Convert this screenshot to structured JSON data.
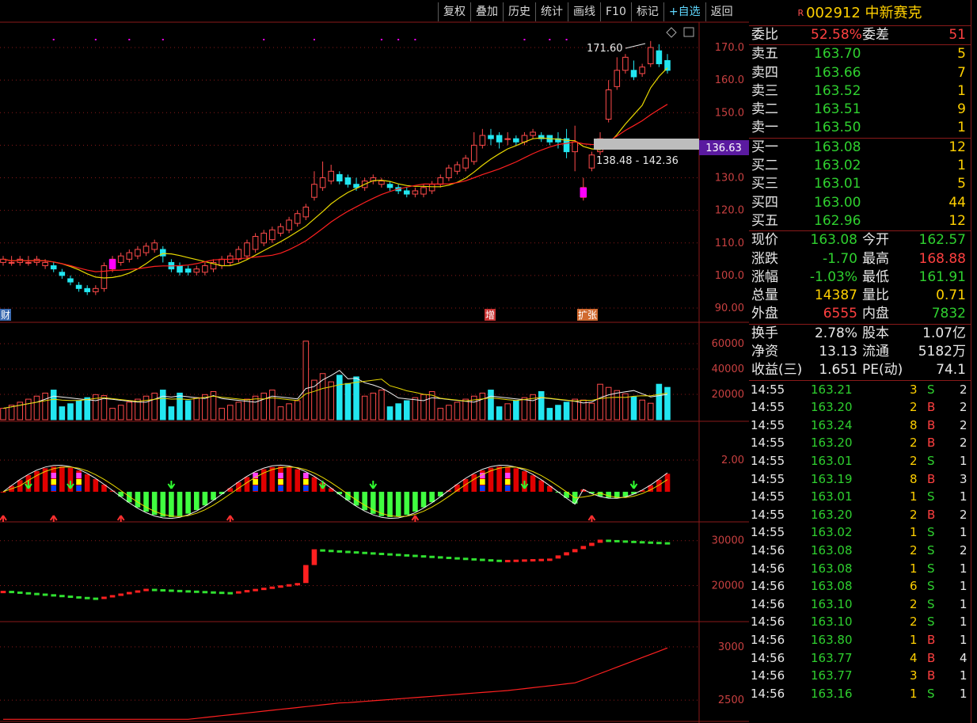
{
  "toolbar": {
    "buttons": [
      "复权",
      "叠加",
      "历史",
      "统计",
      "画线",
      "F10",
      "标记",
      "+自选",
      "返回"
    ]
  },
  "chart": {
    "price_axis": [
      "170.0",
      "160.0",
      "150.0",
      "140.0",
      "130.0",
      "120.0",
      "110.0",
      "100.0",
      "90.00"
    ],
    "cursor_price": "136.63",
    "high_label": "171.60",
    "range_label": "138.48 - 142.36",
    "badges": [
      "财",
      "增",
      "扩张"
    ],
    "volume_axis": [
      "60000",
      "40000",
      "20000"
    ],
    "macd_axis": [
      "2.00"
    ],
    "ind3_axis": [
      "30000",
      "20000"
    ],
    "ind4_axis": [
      "3000",
      "2500"
    ]
  },
  "chart_data": {
    "type": "candlestick",
    "x": [
      1,
      2,
      3,
      4,
      5,
      6,
      7,
      8,
      9,
      10,
      11,
      12,
      13,
      14,
      15,
      16,
      17,
      18,
      19,
      20,
      21,
      22,
      23,
      24,
      25,
      26,
      27,
      28,
      29,
      30,
      31,
      32,
      33,
      34,
      35,
      36,
      37,
      38,
      39,
      40,
      41,
      42,
      43,
      44,
      45,
      46,
      47,
      48,
      49,
      50,
      51,
      52,
      53,
      54,
      55,
      56,
      57,
      58,
      59,
      60,
      61,
      62,
      63,
      64,
      65,
      66,
      67,
      68,
      69,
      70,
      71,
      72,
      73,
      74
    ],
    "open": [
      104,
      104,
      104,
      104,
      104,
      103,
      103,
      101,
      99,
      97,
      96,
      95,
      96,
      102,
      104,
      105,
      106,
      107,
      108,
      108,
      104,
      103,
      102,
      101,
      101,
      102,
      103,
      104,
      105,
      106,
      108,
      110,
      111,
      113,
      114,
      116,
      118,
      124,
      127,
      129,
      131,
      130,
      128,
      127,
      129,
      128,
      128,
      127,
      126,
      125,
      125,
      126,
      128,
      130,
      132,
      133,
      135,
      140,
      143,
      143,
      142,
      142,
      141,
      143,
      143,
      143,
      142,
      142,
      138,
      124,
      133,
      138,
      148,
      158,
      163,
      163,
      162,
      165,
      169,
      166
    ],
    "close": [
      105,
      104,
      105,
      104,
      105,
      104,
      102,
      100,
      98,
      96,
      95,
      96,
      103,
      105,
      106,
      107,
      108,
      109,
      110,
      106,
      102,
      101,
      101,
      102,
      103,
      104,
      105,
      106,
      108,
      110,
      112,
      113,
      114,
      115,
      117,
      119,
      121,
      128,
      130,
      132,
      129,
      128,
      127,
      129,
      130,
      129,
      127,
      126,
      125,
      126,
      127,
      128,
      130,
      133,
      134,
      136,
      140,
      143,
      142,
      141,
      142,
      141,
      143,
      144,
      142,
      141,
      141,
      138,
      141,
      127,
      137,
      142,
      157,
      163,
      167,
      161,
      164,
      170,
      165,
      163
    ],
    "high": [
      106,
      106,
      106,
      106,
      106,
      105,
      104,
      102,
      100,
      98,
      97,
      97,
      104,
      106,
      107,
      108,
      109,
      110,
      111,
      109,
      105,
      104,
      103,
      103,
      104,
      105,
      106,
      107,
      109,
      111,
      113,
      114,
      115,
      116,
      118,
      120,
      122,
      132,
      135,
      134,
      132,
      131,
      130,
      130,
      131,
      130,
      129,
      128,
      127,
      127,
      128,
      129,
      131,
      134,
      135,
      137,
      144,
      145,
      145,
      144,
      144,
      143,
      144,
      145,
      144,
      143,
      144,
      145,
      146,
      130,
      138,
      144,
      160,
      167,
      168,
      166,
      165,
      172,
      171,
      168
    ],
    "low": [
      103,
      103,
      103,
      103,
      103,
      102,
      101,
      99,
      97,
      95,
      94,
      94,
      95,
      101,
      103,
      104,
      105,
      106,
      107,
      104,
      101,
      100,
      100,
      100,
      100,
      101,
      102,
      103,
      104,
      105,
      107,
      109,
      110,
      112,
      113,
      115,
      117,
      123,
      126,
      128,
      128,
      127,
      126,
      126,
      128,
      127,
      126,
      125,
      124,
      124,
      124,
      125,
      127,
      129,
      131,
      132,
      134,
      139,
      140,
      139,
      140,
      140,
      140,
      142,
      141,
      140,
      139,
      136,
      132,
      123,
      132,
      137,
      147,
      157,
      162,
      160,
      161,
      164,
      164,
      162
    ],
    "volume_bar_count": 74
  },
  "panel": {
    "code": "002912",
    "name": "中新赛克",
    "r_mark": "R",
    "weibi_label": "委比",
    "weibi": "52.58%",
    "weicha_label": "委差",
    "weicha": "51",
    "sell": [
      {
        "label": "卖五",
        "price": "163.70",
        "vol": "5"
      },
      {
        "label": "卖四",
        "price": "163.66",
        "vol": "7"
      },
      {
        "label": "卖三",
        "price": "163.52",
        "vol": "1"
      },
      {
        "label": "卖二",
        "price": "163.51",
        "vol": "9"
      },
      {
        "label": "卖一",
        "price": "163.50",
        "vol": "1"
      }
    ],
    "buy": [
      {
        "label": "买一",
        "price": "163.08",
        "vol": "12"
      },
      {
        "label": "买二",
        "price": "163.02",
        "vol": "1"
      },
      {
        "label": "买三",
        "price": "163.01",
        "vol": "5"
      },
      {
        "label": "买四",
        "price": "163.00",
        "vol": "44"
      },
      {
        "label": "买五",
        "price": "162.96",
        "vol": "12"
      }
    ],
    "quote": [
      {
        "l1": "现价",
        "v1": "163.08",
        "c1": "#2fd02f",
        "l2": "今开",
        "v2": "162.57",
        "c2": "#2fd02f"
      },
      {
        "l1": "涨跌",
        "v1": "-1.70",
        "c1": "#2fd02f",
        "l2": "最高",
        "v2": "168.88",
        "c2": "#ff4040"
      },
      {
        "l1": "涨幅",
        "v1": "-1.03%",
        "c1": "#2fd02f",
        "l2": "最低",
        "v2": "161.91",
        "c2": "#2fd02f"
      },
      {
        "l1": "总量",
        "v1": "14387",
        "c1": "#ffd000",
        "l2": "量比",
        "v2": "0.71",
        "c2": "#ffd000"
      },
      {
        "l1": "外盘",
        "v1": "6555",
        "c1": "#ff4040",
        "l2": "内盘",
        "v2": "7832",
        "c2": "#2fd02f"
      }
    ],
    "fund": [
      {
        "l1": "换手",
        "v1": "2.78%",
        "l2": "股本",
        "v2": "1.07亿"
      },
      {
        "l1": "净资",
        "v1": "13.13",
        "l2": "流通",
        "v2": "5182万"
      },
      {
        "l1": "收益(三)",
        "v1": "1.651",
        "l2": "PE(动)",
        "v2": "74.1"
      }
    ],
    "ticks": [
      {
        "t": "14:55",
        "p": "163.21",
        "pc": "#2fd02f",
        "v": "3",
        "s": "S",
        "n": "2"
      },
      {
        "t": "14:55",
        "p": "163.20",
        "pc": "#2fd02f",
        "v": "2",
        "s": "B",
        "n": "2"
      },
      {
        "t": "14:55",
        "p": "163.24",
        "pc": "#2fd02f",
        "v": "8",
        "s": "B",
        "n": "2"
      },
      {
        "t": "14:55",
        "p": "163.20",
        "pc": "#2fd02f",
        "v": "2",
        "s": "B",
        "n": "2"
      },
      {
        "t": "14:55",
        "p": "163.01",
        "pc": "#2fd02f",
        "v": "2",
        "s": "S",
        "n": "1"
      },
      {
        "t": "14:55",
        "p": "163.19",
        "pc": "#2fd02f",
        "v": "8",
        "s": "B",
        "n": "3"
      },
      {
        "t": "14:55",
        "p": "163.01",
        "pc": "#2fd02f",
        "v": "1",
        "s": "S",
        "n": "1"
      },
      {
        "t": "14:55",
        "p": "163.20",
        "pc": "#2fd02f",
        "v": "2",
        "s": "B",
        "n": "2"
      },
      {
        "t": "14:55",
        "p": "163.02",
        "pc": "#2fd02f",
        "v": "1",
        "s": "S",
        "n": "1"
      },
      {
        "t": "14:56",
        "p": "163.08",
        "pc": "#2fd02f",
        "v": "2",
        "s": "S",
        "n": "2"
      },
      {
        "t": "14:56",
        "p": "163.08",
        "pc": "#2fd02f",
        "v": "1",
        "s": "S",
        "n": "1"
      },
      {
        "t": "14:56",
        "p": "163.08",
        "pc": "#2fd02f",
        "v": "6",
        "s": "S",
        "n": "1"
      },
      {
        "t": "14:56",
        "p": "163.10",
        "pc": "#2fd02f",
        "v": "2",
        "s": "S",
        "n": "1"
      },
      {
        "t": "14:56",
        "p": "163.10",
        "pc": "#2fd02f",
        "v": "2",
        "s": "S",
        "n": "1"
      },
      {
        "t": "14:56",
        "p": "163.80",
        "pc": "#2fd02f",
        "v": "1",
        "s": "B",
        "n": "1"
      },
      {
        "t": "14:56",
        "p": "163.77",
        "pc": "#2fd02f",
        "v": "4",
        "s": "B",
        "n": "4"
      },
      {
        "t": "14:56",
        "p": "163.77",
        "pc": "#2fd02f",
        "v": "3",
        "s": "B",
        "n": "1"
      },
      {
        "t": "14:56",
        "p": "163.16",
        "pc": "#2fd02f",
        "v": "1",
        "s": "S",
        "n": "1"
      }
    ]
  },
  "colors": {
    "up": "#ff4a4a",
    "down": "#22e6f0",
    "grid": "#8a1a1a",
    "axis_text": "#c84040",
    "ma1": "#e8d800",
    "ma2": "#ff2020",
    "magenta": "#ff00ff",
    "green": "#2fd02f",
    "yellow": "#ffd000"
  }
}
